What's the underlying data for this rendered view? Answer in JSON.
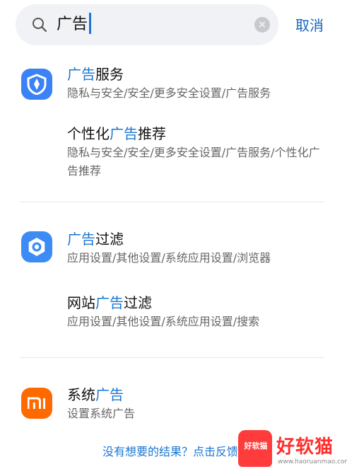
{
  "search": {
    "query": "广告",
    "cancel_label": "取消"
  },
  "results": [
    {
      "title_highlight": "广告",
      "title_rest": "服务",
      "path": "隐私与安全/安全/更多安全设置/广告服务"
    },
    {
      "title_pre": "个性化",
      "title_highlight": "广告",
      "title_rest": "推荐",
      "path": "隐私与安全/安全/更多安全设置/广告服务/个性化广告推荐"
    },
    {
      "title_highlight": "广告",
      "title_rest": "过滤",
      "path": "应用设置/其他设置/系统应用设置/浏览器"
    },
    {
      "title_pre": "网站",
      "title_highlight": "广告",
      "title_rest": "过滤",
      "path": "应用设置/其他设置/系统应用设置/搜索"
    },
    {
      "title_pre": "系统",
      "title_highlight": "广告",
      "path": "设置系统广告"
    }
  ],
  "icons": {
    "security_app": "shield-icon",
    "browser_app": "browser-icon",
    "mi_app": "mi-logo-icon"
  },
  "footer": {
    "feedback_text": "没有想要的结果？点击反馈"
  },
  "watermark": {
    "logo_text": "好软猫",
    "brand": "好软猫",
    "url": "www.haoruanmao.com"
  },
  "colors": {
    "highlight": "#1a76d2",
    "cancel": "#1565c0",
    "security_icon_bg": "#3b82f6",
    "browser_icon_bg": "#3d8bf5",
    "mi_icon_bg": "#ff6a00",
    "watermark_red": "#ff3b3b"
  }
}
